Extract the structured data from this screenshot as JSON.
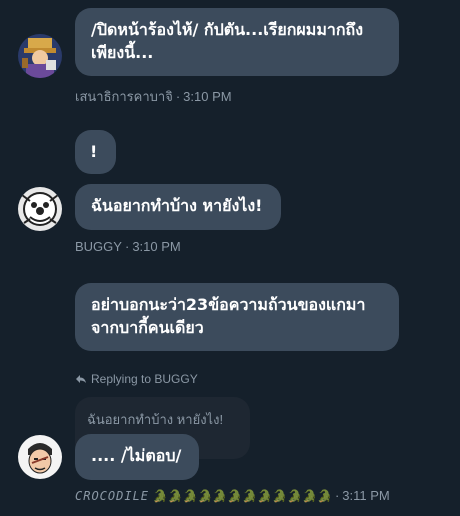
{
  "messages": [
    {
      "text": "/ปิดหน้าร้องไห้/ กัปตัน...เรียกผมมากถึงเพียงนี้...",
      "author": "เสนาธิการคาบาจิ",
      "time": "3:10 PM"
    },
    {
      "bubble1": "!",
      "bubble2": "ฉันอยากทำบ้าง หายังไง!",
      "author": "BUGGY",
      "time": "3:10 PM"
    },
    {
      "text": "อย่าบอกนะว่า23ข้อความถ้วนของแกมาจากบากี้คนเดียว"
    },
    {
      "reply_label": "Replying to BUGGY",
      "quoted_text": "ฉันอยากทำบ้าง หายังไง!",
      "text": ".... /ไม่ตอบ/",
      "author": "CROCODILE",
      "author_decoration": "🐊🐊🐊🐊🐊🐊🐊🐊🐊🐊🐊🐊",
      "time": "3:11 PM"
    }
  ],
  "separator": "·",
  "colors": {
    "background": "#15202b",
    "bubble": "#3c4b5c",
    "meta": "#8b98a5",
    "croc_green": "#3aa655"
  }
}
